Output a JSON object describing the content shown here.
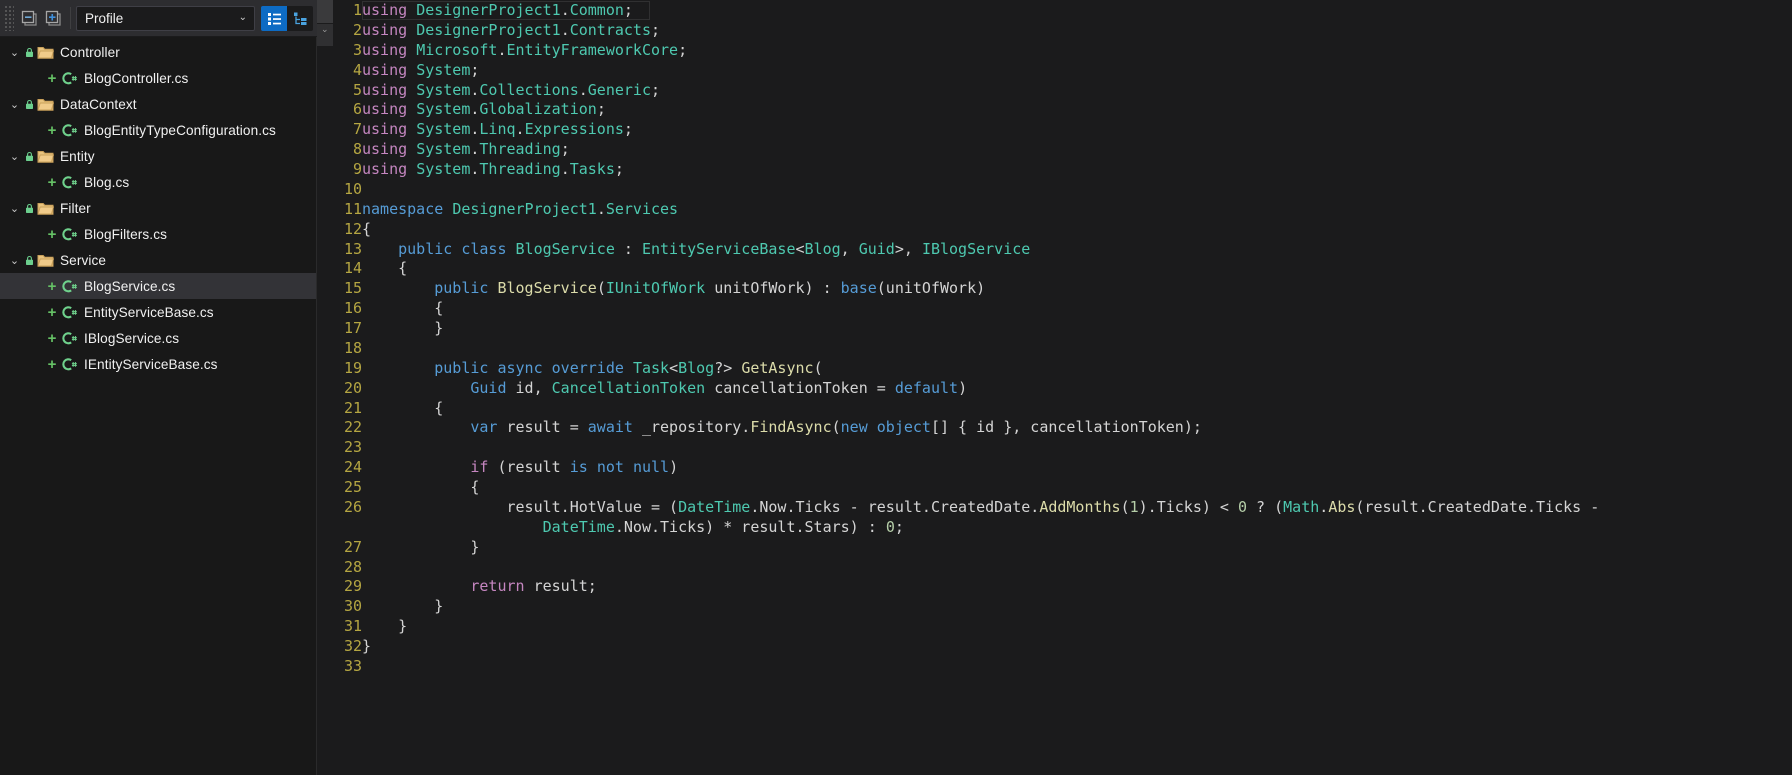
{
  "sidebar": {
    "toolbar": {
      "collapse_all_label": "collapse-all",
      "expand_all_label": "expand-all",
      "profile_select_value": "Profile",
      "chevron": "⌄",
      "view_list_label": "flat-list-view",
      "view_tree_label": "tree-view"
    },
    "tree": [
      {
        "type": "folder",
        "label": "Controller",
        "expanded": true,
        "twisty": "⌄"
      },
      {
        "type": "file",
        "label": "BlogController.cs"
      },
      {
        "type": "folder",
        "label": "DataContext",
        "expanded": true,
        "twisty": "⌄"
      },
      {
        "type": "file",
        "label": "BlogEntityTypeConfiguration.cs"
      },
      {
        "type": "folder",
        "label": "Entity",
        "expanded": true,
        "twisty": "⌄"
      },
      {
        "type": "file",
        "label": "Blog.cs"
      },
      {
        "type": "folder",
        "label": "Filter",
        "expanded": true,
        "twisty": "⌄"
      },
      {
        "type": "file",
        "label": "BlogFilters.cs"
      },
      {
        "type": "folder",
        "label": "Service",
        "expanded": true,
        "twisty": "⌄"
      },
      {
        "type": "file",
        "label": "BlogService.cs",
        "selected": true
      },
      {
        "type": "file",
        "label": "EntityServiceBase.cs"
      },
      {
        "type": "file",
        "label": "IBlogService.cs"
      },
      {
        "type": "file",
        "label": "IEntityServiceBase.cs"
      }
    ]
  },
  "editor": {
    "language": "csharp",
    "file": "BlogService.cs",
    "lines": [
      {
        "n": 1,
        "tokens": [
          [
            "kp",
            "using "
          ],
          [
            "t",
            "DesignerProject1"
          ],
          [
            "p",
            "."
          ],
          [
            "t",
            "Common"
          ],
          [
            "p",
            ";"
          ]
        ]
      },
      {
        "n": 2,
        "tokens": [
          [
            "kp",
            "using "
          ],
          [
            "t",
            "DesignerProject1"
          ],
          [
            "p",
            "."
          ],
          [
            "t",
            "Contracts"
          ],
          [
            "p",
            ";"
          ]
        ]
      },
      {
        "n": 3,
        "tokens": [
          [
            "kp",
            "using "
          ],
          [
            "t",
            "Microsoft"
          ],
          [
            "p",
            "."
          ],
          [
            "t",
            "EntityFrameworkCore"
          ],
          [
            "p",
            ";"
          ]
        ]
      },
      {
        "n": 4,
        "tokens": [
          [
            "kp",
            "using "
          ],
          [
            "t",
            "System"
          ],
          [
            "p",
            ";"
          ]
        ]
      },
      {
        "n": 5,
        "tokens": [
          [
            "kp",
            "using "
          ],
          [
            "t",
            "System"
          ],
          [
            "p",
            "."
          ],
          [
            "t",
            "Collections"
          ],
          [
            "p",
            "."
          ],
          [
            "t",
            "Generic"
          ],
          [
            "p",
            ";"
          ]
        ]
      },
      {
        "n": 6,
        "tokens": [
          [
            "kp",
            "using "
          ],
          [
            "t",
            "System"
          ],
          [
            "p",
            "."
          ],
          [
            "t",
            "Globalization"
          ],
          [
            "p",
            ";"
          ]
        ]
      },
      {
        "n": 7,
        "tokens": [
          [
            "kp",
            "using "
          ],
          [
            "t",
            "System"
          ],
          [
            "p",
            "."
          ],
          [
            "t",
            "Linq"
          ],
          [
            "p",
            "."
          ],
          [
            "t",
            "Expressions"
          ],
          [
            "p",
            ";"
          ]
        ]
      },
      {
        "n": 8,
        "tokens": [
          [
            "kp",
            "using "
          ],
          [
            "t",
            "System"
          ],
          [
            "p",
            "."
          ],
          [
            "t",
            "Threading"
          ],
          [
            "p",
            ";"
          ]
        ]
      },
      {
        "n": 9,
        "tokens": [
          [
            "kp",
            "using "
          ],
          [
            "t",
            "System"
          ],
          [
            "p",
            "."
          ],
          [
            "t",
            "Threading"
          ],
          [
            "p",
            "."
          ],
          [
            "t",
            "Tasks"
          ],
          [
            "p",
            ";"
          ]
        ]
      },
      {
        "n": 10,
        "tokens": []
      },
      {
        "n": 11,
        "tokens": [
          [
            "k",
            "namespace "
          ],
          [
            "t",
            "DesignerProject1"
          ],
          [
            "p",
            "."
          ],
          [
            "t",
            "Services"
          ]
        ]
      },
      {
        "n": 12,
        "tokens": [
          [
            "p",
            "{"
          ]
        ]
      },
      {
        "n": 13,
        "tokens": [
          [
            "p",
            "    "
          ],
          [
            "k",
            "public "
          ],
          [
            "k",
            "class "
          ],
          [
            "t",
            "BlogService"
          ],
          [
            "p",
            " : "
          ],
          [
            "t",
            "EntityServiceBase"
          ],
          [
            "p",
            "<"
          ],
          [
            "t",
            "Blog"
          ],
          [
            "p",
            ", "
          ],
          [
            "t",
            "Guid"
          ],
          [
            "p",
            ">, "
          ],
          [
            "t",
            "IBlogService"
          ]
        ]
      },
      {
        "n": 14,
        "tokens": [
          [
            "p",
            "    {"
          ]
        ]
      },
      {
        "n": 15,
        "tokens": [
          [
            "p",
            "        "
          ],
          [
            "k",
            "public "
          ],
          [
            "m",
            "BlogService"
          ],
          [
            "p",
            "("
          ],
          [
            "t",
            "IUnitOfWork"
          ],
          [
            "p",
            " unitOfWork) : "
          ],
          [
            "k",
            "base"
          ],
          [
            "p",
            "(unitOfWork)"
          ]
        ]
      },
      {
        "n": 16,
        "tokens": [
          [
            "p",
            "        {"
          ]
        ]
      },
      {
        "n": 17,
        "tokens": [
          [
            "p",
            "        }"
          ]
        ]
      },
      {
        "n": 18,
        "tokens": []
      },
      {
        "n": 19,
        "tokens": [
          [
            "p",
            "        "
          ],
          [
            "k",
            "public "
          ],
          [
            "k",
            "async "
          ],
          [
            "k",
            "override "
          ],
          [
            "t",
            "Task"
          ],
          [
            "p",
            "<"
          ],
          [
            "t",
            "Blog"
          ],
          [
            "p",
            "?> "
          ],
          [
            "m",
            "GetAsync"
          ],
          [
            "p",
            "("
          ]
        ]
      },
      {
        "n": 20,
        "tokens": [
          [
            "p",
            "            "
          ],
          [
            "k",
            "Guid"
          ],
          [
            "p",
            " id, "
          ],
          [
            "t",
            "CancellationToken"
          ],
          [
            "p",
            " cancellationToken = "
          ],
          [
            "k",
            "default"
          ],
          [
            "p",
            ")"
          ]
        ]
      },
      {
        "n": 21,
        "tokens": [
          [
            "p",
            "        {"
          ]
        ]
      },
      {
        "n": 22,
        "tokens": [
          [
            "p",
            "            "
          ],
          [
            "k",
            "var"
          ],
          [
            "p",
            " result = "
          ],
          [
            "k",
            "await"
          ],
          [
            "p",
            " _repository."
          ],
          [
            "m",
            "FindAsync"
          ],
          [
            "p",
            "("
          ],
          [
            "k",
            "new "
          ],
          [
            "k",
            "object"
          ],
          [
            "p",
            "[] { id }, cancellationToken);"
          ]
        ]
      },
      {
        "n": 23,
        "tokens": []
      },
      {
        "n": 24,
        "tokens": [
          [
            "p",
            "            "
          ],
          [
            "ctl",
            "if"
          ],
          [
            "p",
            " (result "
          ],
          [
            "k",
            "is"
          ],
          [
            "p",
            " "
          ],
          [
            "k",
            "not"
          ],
          [
            "p",
            " "
          ],
          [
            "k",
            "null"
          ],
          [
            "p",
            ")"
          ]
        ]
      },
      {
        "n": 25,
        "tokens": [
          [
            "p",
            "            {"
          ]
        ]
      },
      {
        "n": 26,
        "tokens": [
          [
            "p",
            "                result.HotValue = ("
          ],
          [
            "t",
            "DateTime"
          ],
          [
            "p",
            ".Now.Ticks - result.CreatedDate."
          ],
          [
            "m",
            "AddMonths"
          ],
          [
            "p",
            "("
          ],
          [
            "num",
            "1"
          ],
          [
            "p",
            ").Ticks) < "
          ],
          [
            "num",
            "0"
          ],
          [
            "p",
            " ? ("
          ],
          [
            "t",
            "Math"
          ],
          [
            "p",
            "."
          ],
          [
            "m",
            "Abs"
          ],
          [
            "p",
            "(result.CreatedDate.Ticks - "
          ]
        ]
      },
      {
        "n": "",
        "tokens": [
          [
            "p",
            "                    "
          ],
          [
            "t",
            "DateTime"
          ],
          [
            "p",
            ".Now.Ticks) * result.Stars) : "
          ],
          [
            "num",
            "0"
          ],
          [
            "p",
            ";"
          ]
        ]
      },
      {
        "n": 27,
        "tokens": [
          [
            "p",
            "            }"
          ]
        ]
      },
      {
        "n": 28,
        "tokens": []
      },
      {
        "n": 29,
        "tokens": [
          [
            "p",
            "            "
          ],
          [
            "ctl",
            "return"
          ],
          [
            "p",
            " result;"
          ]
        ]
      },
      {
        "n": 30,
        "tokens": [
          [
            "p",
            "        }"
          ]
        ]
      },
      {
        "n": 31,
        "tokens": [
          [
            "p",
            "    }"
          ]
        ]
      },
      {
        "n": 32,
        "tokens": [
          [
            "p",
            "}"
          ]
        ]
      },
      {
        "n": 33,
        "tokens": []
      }
    ]
  },
  "colors": {
    "background": "#1b1b1c",
    "sidebar_background": "#181818",
    "toolbar_background": "#2d2d30",
    "selection": "#333337",
    "accent_blue": "#0d6bc4",
    "keyword": "#569cd6",
    "keyword_purple": "#c586c0",
    "type": "#4ec9b0",
    "method": "#dcdcaa",
    "number": "#b5cea8",
    "plain_text": "#d4d4d4",
    "line_number": "#2b91af",
    "line_number_gold": "#b5a642",
    "csharp_icon_green": "#66c266",
    "folder_yellow": "#dcb67a"
  }
}
